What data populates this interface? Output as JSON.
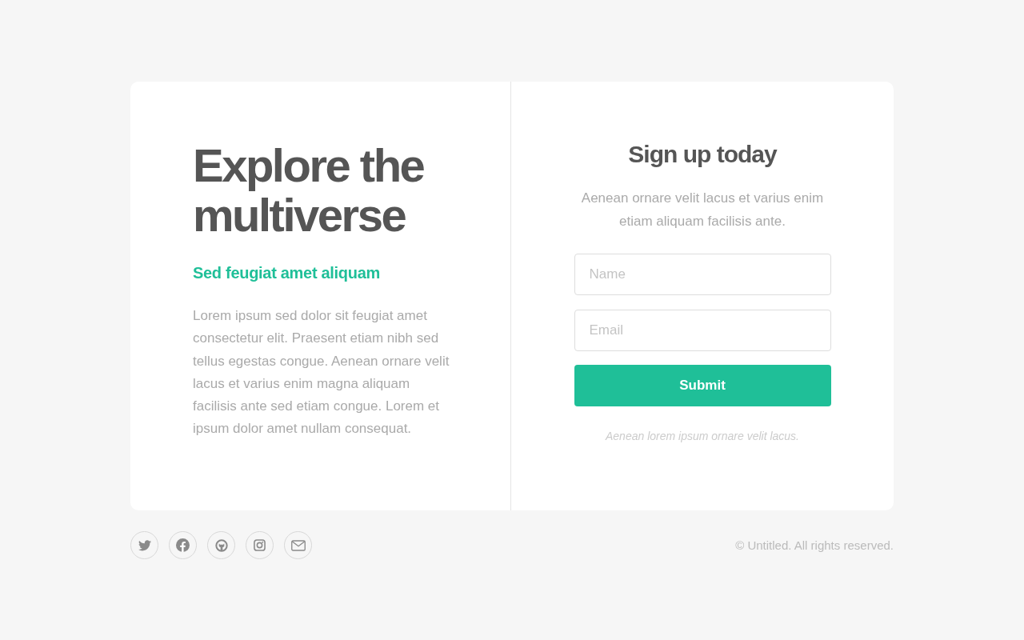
{
  "intro": {
    "title_lines": [
      "Explore the",
      "multiverse"
    ],
    "subtitle": "Sed feugiat amet aliquam",
    "body": "Lorem ipsum sed dolor sit feugiat amet consectetur elit. Praesent etiam nibh sed tellus egestas congue. Aenean ornare velit lacus et varius enim magna aliquam facilisis ante sed etiam congue. Lorem et ipsum dolor amet nullam consequat."
  },
  "signup": {
    "title": "Sign up today",
    "description": "Aenean ornare velit lacus et varius enim etiam aliquam facilisis ante.",
    "fields": [
      {
        "placeholder": "Name"
      },
      {
        "placeholder": "Email"
      }
    ],
    "button": "Submit",
    "note": "Aenean lorem ipsum ornare velit lacus."
  },
  "footer": {
    "social": [
      {
        "kind": "twitter"
      },
      {
        "kind": "facebook"
      },
      {
        "kind": "github"
      },
      {
        "kind": "instagram"
      },
      {
        "kind": "email"
      }
    ],
    "copyright": "© Untitled. All rights reserved."
  }
}
